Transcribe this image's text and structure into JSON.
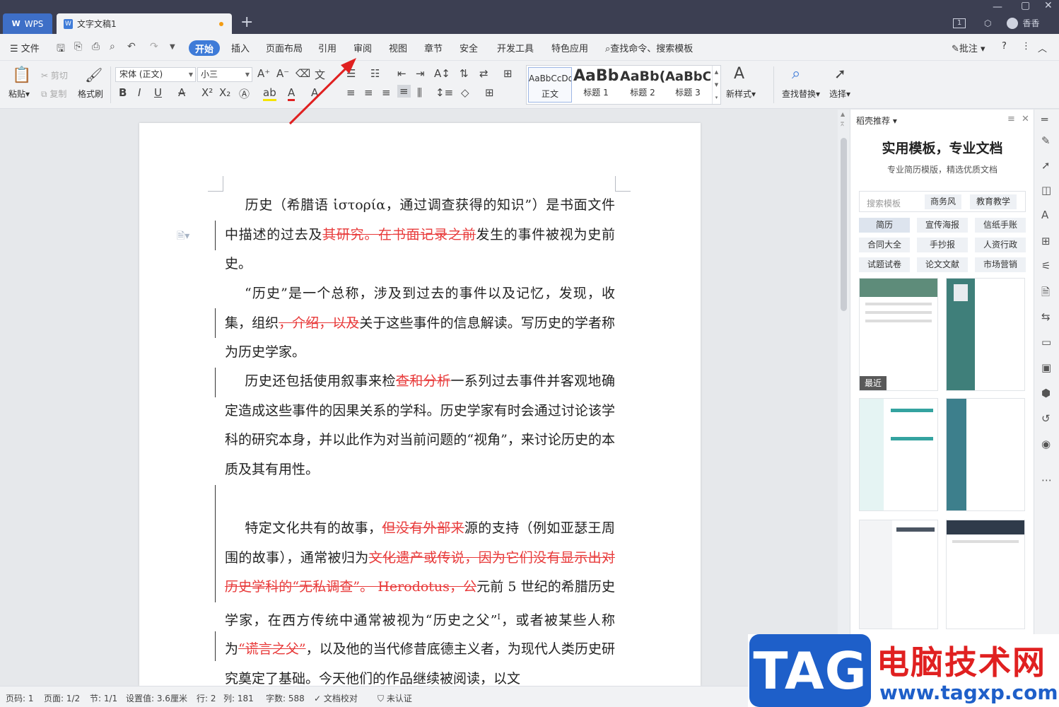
{
  "titlebar": {
    "app_tab": "WPS",
    "doc_tab": "文字文稿1",
    "new_tab": "+",
    "user": "香香",
    "badge": "1"
  },
  "menubar": {
    "file": "文件",
    "items": [
      "开始",
      "插入",
      "页面布局",
      "引用",
      "审阅",
      "视图",
      "章节",
      "安全",
      "开发工具",
      "特色应用"
    ],
    "search": "查找命令、搜索模板",
    "comment": "批注"
  },
  "ribbon": {
    "paste": "粘贴",
    "cut": "剪切",
    "copy": "复制",
    "format_painter": "格式刷",
    "font_name": "宋体 (正文)",
    "font_size": "小三",
    "styles": [
      {
        "sample": "AaBbCcDd",
        "label": "正文"
      },
      {
        "sample": "AaBb",
        "label": "标题 1"
      },
      {
        "sample": "AaBb(",
        "label": "标题 2"
      },
      {
        "sample": "AaBbC(",
        "label": "标题 3"
      }
    ],
    "new_style": "新样式",
    "find_replace": "查找替换",
    "select": "选择"
  },
  "document": {
    "p1": {
      "a": "历史（希腊语 ἱστορία，通过调查获得的知识”）是书面文件中描述的过去及",
      "del": "其研究。在书面记录之前",
      "b": "发生的事件被视为史前史。"
    },
    "p2": {
      "a": "“历史”是一个总称，涉及到过去的事件以及记忆，发现，收集，组织",
      "del": "，介绍，以及",
      "b": "关于这些事件的信息解读。写历史的学者称为历史学家。"
    },
    "p3": {
      "a": "历史还包括使用叙事来检",
      "del": "查和分析",
      "b": "一系列过去事件并客观地确定造成这些事件的因果关系的学科。历史学家有时会通过讨论该学科的研究本身，并以此作为对当前问题的“视角”，来讨论历史的本质及其有用性。"
    },
    "p4": {
      "a": "特定文化共有的故事，",
      "del1": "但没有外部来",
      "b": "源的支持（例如亚瑟王周围的故事），通常被归为",
      "del2": "文化遗产或传说，因为它们没有显示出对历史学科的“无私调查”。 Herodotus，公",
      "c": "元前 5 世纪的希腊历史学家，在西方传统中通常被视为“历史之父”",
      "sup": "I",
      "d": "，或者被某些人称为",
      "del3": "“谎言之父”",
      "e": "，以及他的当代修昔底德主义者，为现代人类历史研究奠定了基础。今天他们的作品继续被阅读，以文"
    }
  },
  "panel": {
    "header": "稻壳推荐",
    "title": "实用模板，专业文档",
    "subtitle": "专业简历模版，精选优质文档",
    "search_placeholder": "搜索模板",
    "search_chips": [
      "商务风",
      "教育教学"
    ],
    "categories": [
      "简历",
      "宣传海报",
      "信纸手账",
      "合同大全",
      "手抄报",
      "人资行政",
      "试题试卷",
      "论文文献",
      "市场营销"
    ],
    "recent": "最近"
  },
  "statusbar": {
    "page_code": "页码: 1",
    "page": "页面: 1/2",
    "section": "节: 1/1",
    "setting": "设置值: 3.6厘米",
    "row": "行: 2",
    "col": "列: 181",
    "words": "字数: 588",
    "proof": "文档校对",
    "cert": "未认证"
  },
  "watermark": {
    "tag": "TAG",
    "site_cn": "电脑技术网",
    "url": "www.tagxp.com"
  },
  "colors": {
    "titlebar": "#3c3f52",
    "accent": "#3e7bd8",
    "deleted_text": "#e83a3a",
    "arrow": "#e02020"
  }
}
